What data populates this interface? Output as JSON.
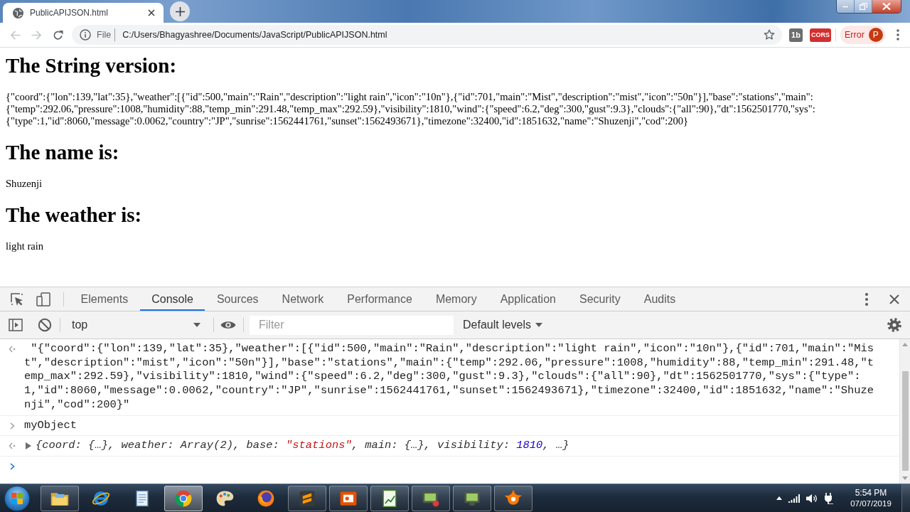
{
  "browser": {
    "tab": {
      "title": "PublicAPIJSON.html"
    },
    "back": {
      "disabled": true
    },
    "forward": {
      "disabled": true
    },
    "address": {
      "scheme_label": "File",
      "url": "C:/Users/Bhagyashree/Documents/JavaScript/PublicAPIJSON.html"
    },
    "extensions": [
      {
        "label": "1b",
        "kind": "gray"
      },
      {
        "label": "CORS",
        "kind": "red"
      }
    ],
    "profile": {
      "status": "Error",
      "initial": "P"
    }
  },
  "page": {
    "sections": [
      {
        "heading": "The String version:",
        "text": "{\"coord\":{\"lon\":139,\"lat\":35},\"weather\":[{\"id\":500,\"main\":\"Rain\",\"description\":\"light rain\",\"icon\":\"10n\"},{\"id\":701,\"main\":\"Mist\",\"description\":\"mist\",\"icon\":\"50n\"}],\"base\":\"stations\",\"main\":{\"temp\":292.06,\"pressure\":1008,\"humidity\":88,\"temp_min\":291.48,\"temp_max\":292.59},\"visibility\":1810,\"wind\":{\"speed\":6.2,\"deg\":300,\"gust\":9.3},\"clouds\":{\"all\":90},\"dt\":1562501770,\"sys\":{\"type\":1,\"id\":8060,\"message\":0.0062,\"country\":\"JP\",\"sunrise\":1562441761,\"sunset\":1562493671},\"timezone\":32400,\"id\":1851632,\"name\":\"Shuzenji\",\"cod\":200}"
      },
      {
        "heading": "The name is:",
        "text": "Shuzenji"
      },
      {
        "heading": "The weather is:",
        "text": "light rain"
      }
    ]
  },
  "devtools": {
    "tabs": [
      {
        "label": "Elements",
        "selected": false
      },
      {
        "label": "Console",
        "selected": true
      },
      {
        "label": "Sources",
        "selected": false
      },
      {
        "label": "Network",
        "selected": false
      },
      {
        "label": "Performance",
        "selected": false
      },
      {
        "label": "Memory",
        "selected": false
      },
      {
        "label": "Application",
        "selected": false
      },
      {
        "label": "Security",
        "selected": false
      },
      {
        "label": "Audits",
        "selected": false
      }
    ],
    "context": "top",
    "filter": {
      "placeholder": "Filter"
    },
    "levels": "Default levels",
    "console": {
      "entries": [
        {
          "kind": "result",
          "text": "\"{\"coord\":{\"lon\":139,\"lat\":35},\"weather\":[{\"id\":500,\"main\":\"Rain\",\"description\":\"light rain\",\"icon\":\"10n\"},{\"id\":701,\"main\":\"Mist\",\"description\":\"mist\",\"icon\":\"50n\"}],\"base\":\"stations\",\"main\":{\"temp\":292.06,\"pressure\":1008,\"humidity\":88,\"temp_min\":291.48,\"temp_max\":292.59},\"visibility\":1810,\"wind\":{\"speed\":6.2,\"deg\":300,\"gust\":9.3},\"clouds\":{\"all\":90},\"dt\":1562501770,\"sys\":{\"type\":1,\"id\":8060,\"message\":0.0062,\"country\":\"JP\",\"sunrise\":1562441761,\"sunset\":1562493671},\"timezone\":32400,\"id\":1851632,\"name\":\"Shuzenji\",\"cod\":200}\""
        },
        {
          "kind": "input",
          "text": "myObject"
        },
        {
          "kind": "object",
          "expanded": false,
          "preview": [
            {
              "kind": "plain",
              "text": "{coord: {…}, weather: Array(2), base: "
            },
            {
              "kind": "string",
              "text": "\"stations\""
            },
            {
              "kind": "plain",
              "text": ", main: {…}, visibility: "
            },
            {
              "kind": "number",
              "text": "1810"
            },
            {
              "kind": "plain",
              "text": ", …}"
            }
          ]
        }
      ]
    }
  },
  "taskbar": {
    "apps": [
      {
        "kind": "folder",
        "running": true,
        "selected": false
      },
      {
        "kind": "e-logo",
        "running": false,
        "selected": false
      },
      {
        "kind": "notepad",
        "running": false,
        "selected": false
      },
      {
        "kind": "browser",
        "running": true,
        "selected": true
      },
      {
        "kind": "palette",
        "running": false,
        "selected": false
      },
      {
        "kind": "fox",
        "running": false,
        "selected": false
      },
      {
        "kind": "editor",
        "running": true,
        "selected": false
      },
      {
        "kind": "presentation",
        "running": true,
        "selected": false
      },
      {
        "kind": "chart",
        "running": true,
        "selected": false
      },
      {
        "kind": "monitor-alert",
        "running": true,
        "selected": false
      },
      {
        "kind": "monitor",
        "running": true,
        "selected": false
      },
      {
        "kind": "splash",
        "running": true,
        "selected": false
      }
    ],
    "clock": {
      "time": "5:54 PM",
      "date": "07/07/2019"
    }
  }
}
